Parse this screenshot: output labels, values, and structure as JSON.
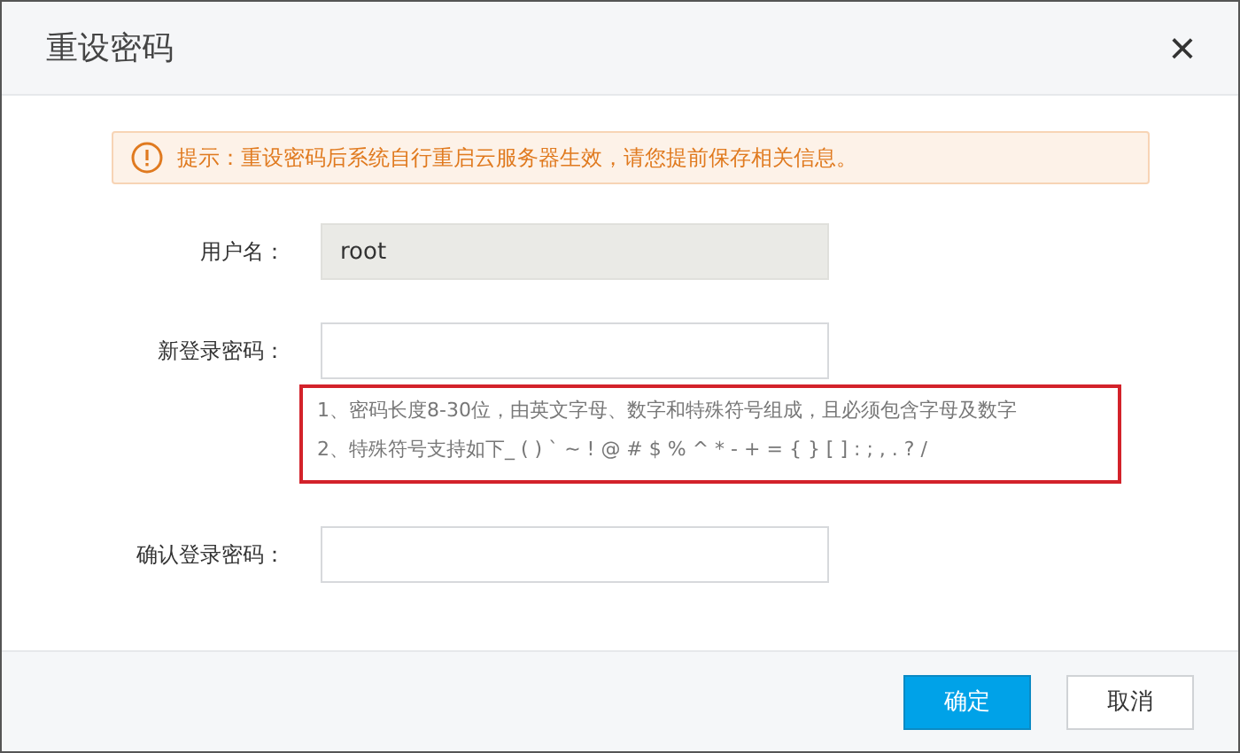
{
  "dialog": {
    "title": "重设密码",
    "close": "×"
  },
  "alert": {
    "text": "提示：重设密码后系统自行重启云服务器生效，请您提前保存相关信息。"
  },
  "form": [
    {
      "label": "用户名：",
      "value": "root",
      "disabled": true
    },
    {
      "label": "新登录密码：",
      "disabled": false,
      "hints": [
        "1、密码长度8-30位，由英文字母、数字和特殊符号组成，且必须包含字母及数字",
        "2、特殊符号支持如下_ ( ) ` ~ ! @ # $ % ^ * - + = { } [ ] : ; , . ? /"
      ],
      "highlighted": true
    },
    {
      "label": "确认登录密码：",
      "disabled": false
    }
  ],
  "buttons": [
    {
      "label": "确定",
      "primary": true
    },
    {
      "label": "取消",
      "primary": false
    }
  ]
}
